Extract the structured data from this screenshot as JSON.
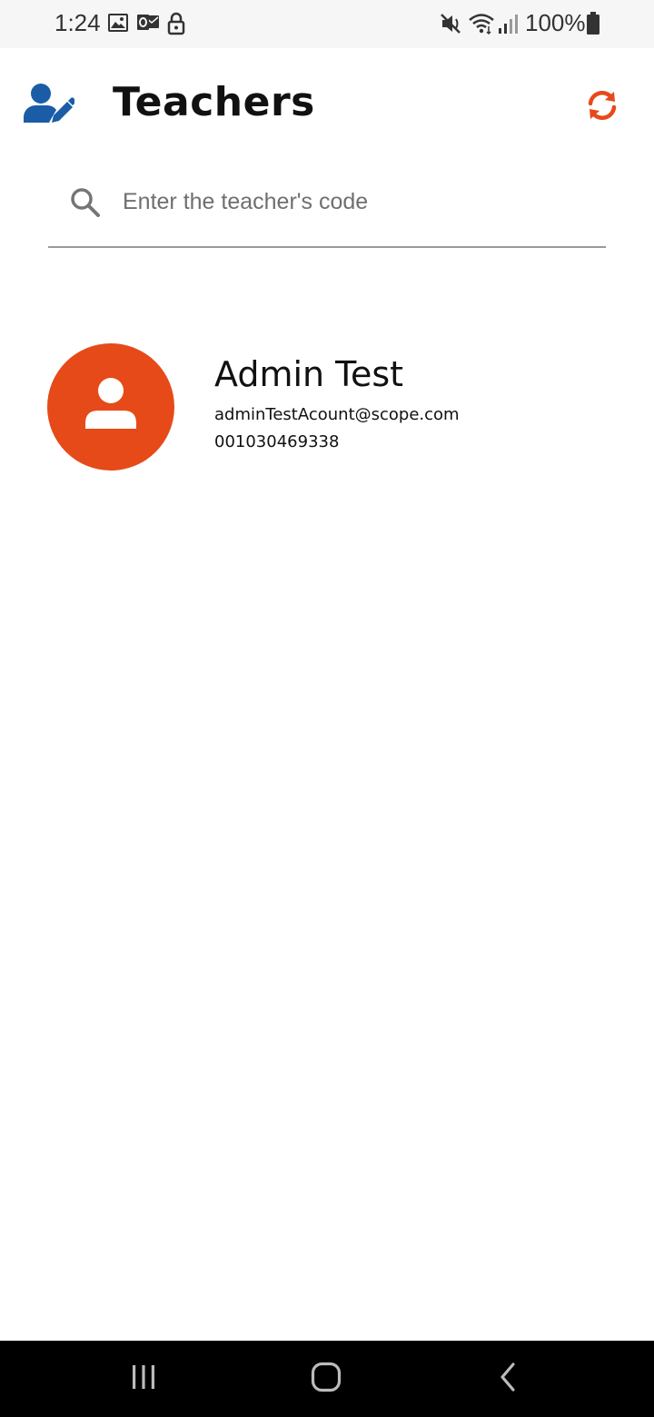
{
  "status_bar": {
    "time": "1:24",
    "battery": "100%",
    "icons": [
      "gallery-icon",
      "outlook-icon",
      "lock-icon",
      "mute-vibrate-icon",
      "wifi-icon",
      "signal-icon",
      "battery-icon"
    ]
  },
  "header": {
    "title": "Teachers",
    "app_icon": "user-edit-icon",
    "refresh_icon": "refresh-icon"
  },
  "search": {
    "placeholder": "Enter the teacher's code",
    "value": ""
  },
  "teachers": [
    {
      "name": "Admin Test",
      "email": "adminTestAcount@scope.com",
      "code": "001030469338",
      "avatar_icon": "person-icon"
    }
  ],
  "nav_bar": {
    "buttons": [
      "recent-apps-icon",
      "home-icon",
      "back-icon"
    ]
  },
  "colors": {
    "accent": "#e64a19",
    "primary_blue": "#1a5da6",
    "status_bar_bg": "#f6f6f6",
    "nav_bar_bg": "#000000"
  }
}
